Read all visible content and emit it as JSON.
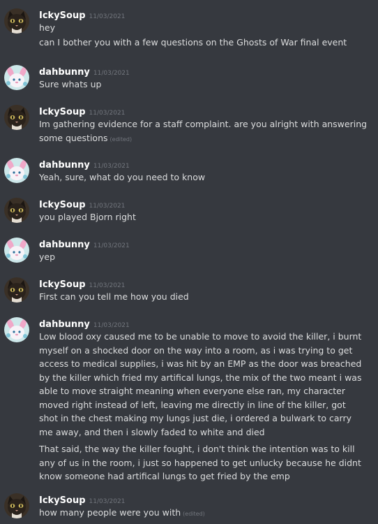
{
  "messages": [
    {
      "user": "IckySoup",
      "avatar": "cat-avatar-icon",
      "time": "11/03/2021",
      "lines": [
        "hey",
        "can I bother you with a few questions on the Ghosts of War final event"
      ]
    },
    {
      "user": "dahbunny",
      "avatar": "bunny-avatar-icon",
      "time": "11/03/2021",
      "lines": [
        "Sure whats up"
      ]
    },
    {
      "user": "IckySoup",
      "avatar": "cat-avatar-icon",
      "time": "11/03/2021",
      "lines": [
        "Im gathering evidence for a staff complaint. are you alright with answering",
        "some questions"
      ],
      "edited": "(edited)"
    },
    {
      "user": "dahbunny",
      "avatar": "bunny-avatar-icon",
      "time": "11/03/2021",
      "lines": [
        "Yeah, sure, what do you need to know"
      ]
    },
    {
      "user": "IckySoup",
      "avatar": "cat-avatar-icon",
      "time": "11/03/2021",
      "lines": [
        "you played Bjorn right"
      ]
    },
    {
      "user": "dahbunny",
      "avatar": "bunny-avatar-icon",
      "time": "11/03/2021",
      "lines": [
        "yep"
      ]
    },
    {
      "user": "IckySoup",
      "avatar": "cat-avatar-icon",
      "time": "11/03/2021",
      "lines": [
        "First can you tell me how you died"
      ]
    },
    {
      "user": "dahbunny",
      "avatar": "bunny-avatar-icon",
      "time": "11/03/2021",
      "paragraphs": [
        "Low blood oxy caused me to be unable to move to avoid the killer, i burnt myself on a shocked door on the way into a room, as i was trying to get access to medical supplies, i was hit by an EMP as the door was breached by the killer which fried my artifical lungs, the mix of the two meant i was able to move straight meaning when everyone else ran, my character moved right instead of left, leaving me directly in line of the killer, got shot in the chest making my lungs just die, i ordered a bulwark to carry me away, and then i slowly faded to white and died",
        "That said, the way the killer fought, i don't think the intention was to kill any of us in the room, i just so happened to get unlucky because he didnt know someone had artifical lungs to get fried by the emp"
      ]
    },
    {
      "user": "IckySoup",
      "avatar": "cat-avatar-icon",
      "time": "11/03/2021",
      "lines": [
        "how many people were you with"
      ],
      "edited": "(edited)"
    }
  ]
}
